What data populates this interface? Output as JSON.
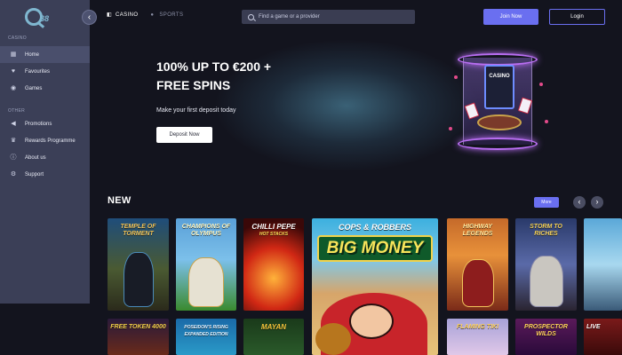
{
  "brand": {
    "logo_text": "Q88"
  },
  "header": {
    "tabs": [
      {
        "label": "CASINO",
        "icon": "dice-icon",
        "active": true
      },
      {
        "label": "SPORTS",
        "icon": "ball-icon",
        "active": false
      }
    ],
    "search_placeholder": "Find a game or a provider",
    "join_label": "Join Now",
    "login_label": "Login"
  },
  "sidebar": {
    "casino_heading": "CASINO",
    "casino_items": [
      {
        "label": "Home",
        "icon": "grid-icon",
        "active": true
      },
      {
        "label": "Favourites",
        "icon": "heart-icon",
        "active": false
      },
      {
        "label": "Games",
        "icon": "gamepad-icon",
        "active": false
      }
    ],
    "other_heading": "OTHER",
    "other_items": [
      {
        "label": "Promotions",
        "icon": "megaphone-icon"
      },
      {
        "label": "Rewards Programme",
        "icon": "trophy-icon"
      },
      {
        "label": "About us",
        "icon": "info-icon"
      },
      {
        "label": "Support",
        "icon": "gear-icon"
      }
    ]
  },
  "hero": {
    "title": "100% UP TO €200 +\nFREE SPINS",
    "subtitle": "Make your first deposit today",
    "cta": "Deposit Now",
    "art_label": "CASINO"
  },
  "new_section": {
    "title": "NEW",
    "more_label": "More",
    "games_row1": [
      {
        "name": "TEMPLE OF TORMENT"
      },
      {
        "name": "CHAMPIONS OF OLYMPUS"
      },
      {
        "name": "CHILLI PEPE",
        "sub": "HOT STACKS"
      },
      {
        "name": "COPS & ROBBERS",
        "sub": "BIG MONEY"
      },
      {
        "name": "HIGHWAY LEGENDS"
      },
      {
        "name": "STORM TO RICHES"
      },
      {
        "name": ""
      }
    ],
    "games_row2": [
      {
        "name": "FREE TOKEN 4000"
      },
      {
        "name": "POSEIDON'S RISING EXPANDED EDITION"
      },
      {
        "name": "MAYAN"
      },
      {
        "name": "FLAMING TIKI"
      },
      {
        "name": "PROSPECTOR WILDS"
      },
      {
        "name": "LIVE"
      }
    ]
  },
  "colors": {
    "accent": "#6a6ff0",
    "sidebar": "#3b3f57",
    "background": "#13141e"
  }
}
